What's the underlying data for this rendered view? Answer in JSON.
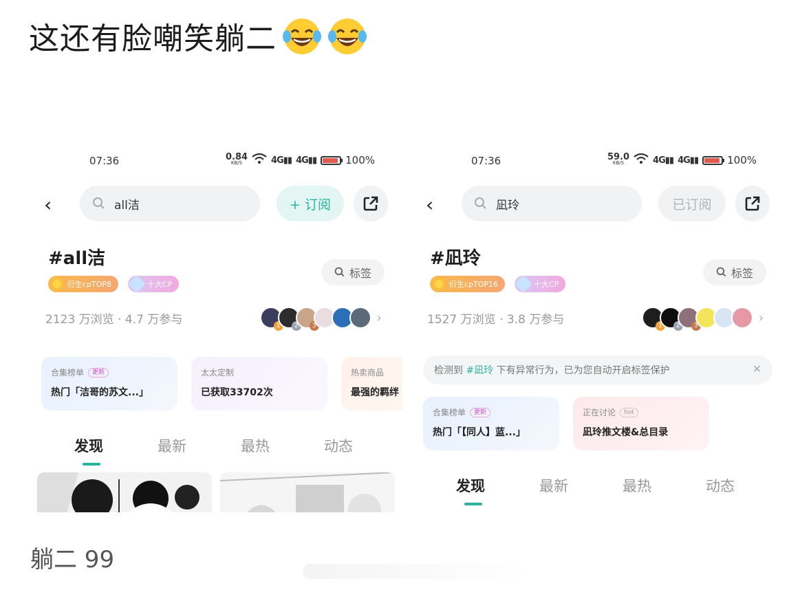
{
  "post": {
    "title": "这还有脸嘲笑躺二",
    "emojis": [
      "laughing-tears",
      "laughing-tears"
    ]
  },
  "phones": {
    "left": {
      "status": {
        "time": "07:36",
        "speed": "0.84",
        "speed_unit": "KB/S",
        "sig1": "4G",
        "sig2": "4G",
        "battery": "100%"
      },
      "search_text": "all洁",
      "subscribe_label": "+ 订阅",
      "tag_name": "#all洁",
      "tag_button_label": "标签",
      "badge_gold": "衍生cpTOP8",
      "badge_pink": "十大CP",
      "stats": "2123 万浏览 · 4.7 万参与",
      "avatar_ranks": [
        "1",
        "2",
        "3"
      ],
      "cards": [
        {
          "key": "合集榜单",
          "pill": "更新",
          "value": "热门「洁哥的苏文...」"
        },
        {
          "key": "太太定制",
          "value": "已获取33702次"
        },
        {
          "key": "热卖商品",
          "value": "最强的羁绊"
        }
      ],
      "tabs": [
        "发现",
        "最新",
        "最热",
        "动态"
      ]
    },
    "right": {
      "status": {
        "time": "07:36",
        "speed": "59.0",
        "speed_unit": "KB/S",
        "sig1": "4G",
        "sig2": "4G",
        "battery": "100%"
      },
      "search_text": "凪玲",
      "subscribe_label": "已订阅",
      "tag_name": "#凪玲",
      "tag_button_label": "标签",
      "badge_gold": "衍生cpTOP16",
      "badge_pink": "十大CP",
      "stats": "1527 万浏览 · 3.8 万参与",
      "avatar_ranks": [
        "1",
        "2",
        "3"
      ],
      "notice_prefix": "检测到",
      "notice_tag": "#凪玲",
      "notice_suffix": "下有异常行为，已为您自动开启标签保护",
      "cards": [
        {
          "key": "合集榜单",
          "pill": "更新",
          "value": "热门「【同人】蓝...」"
        },
        {
          "key": "正在讨论",
          "pill": "hot",
          "value": "凪玲推文楼&总目录"
        }
      ],
      "tabs": [
        "发现",
        "最新",
        "最热",
        "动态"
      ]
    }
  },
  "comment": {
    "text": "躺二 99"
  },
  "colors": {
    "accent": "#2bb39f",
    "badge_gold": "#f8b94a",
    "badge_pink": "#f3a9dd"
  }
}
